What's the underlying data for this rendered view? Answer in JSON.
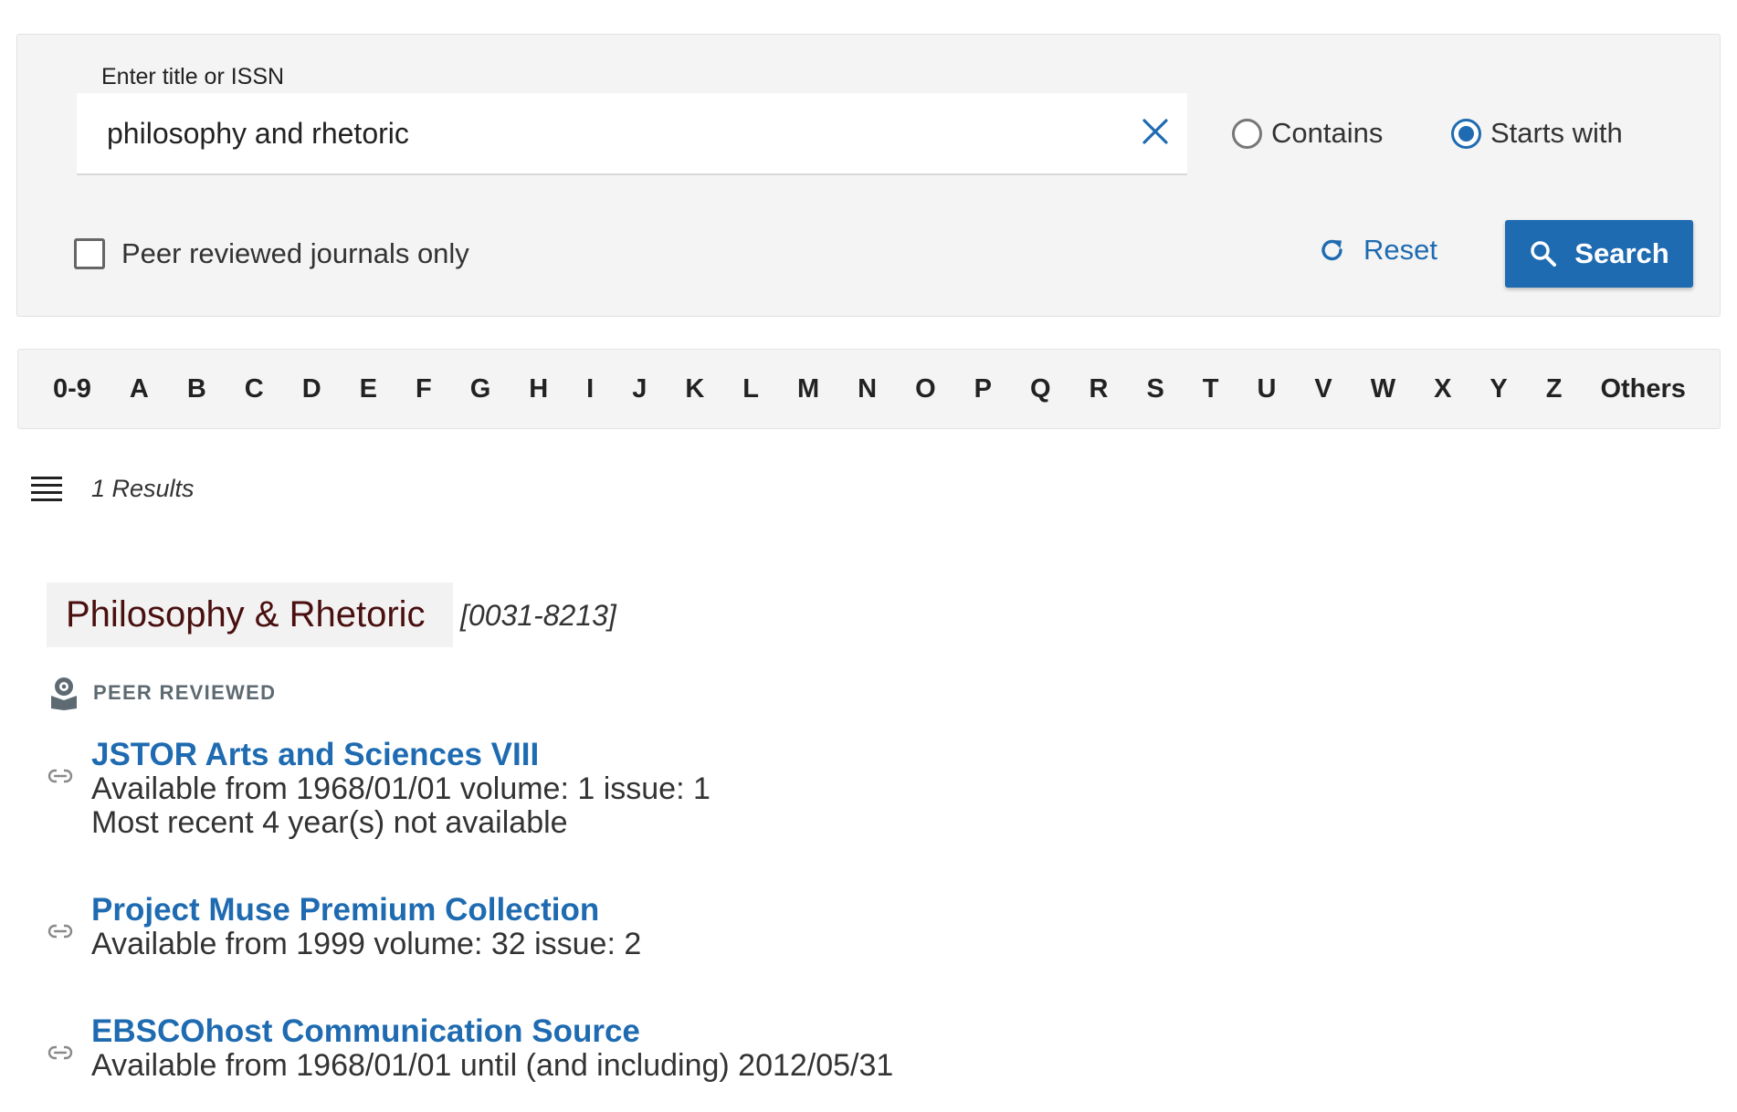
{
  "search": {
    "label": "Enter title or ISSN",
    "value": "philosophy and rhetoric",
    "options": [
      {
        "label": "Contains",
        "selected": false
      },
      {
        "label": "Starts with",
        "selected": true
      }
    ],
    "peer_reviewed_only": {
      "label": "Peer reviewed journals only",
      "checked": false
    },
    "reset_label": "Reset",
    "search_label": "Search"
  },
  "alphabet": [
    "0-9",
    "A",
    "B",
    "C",
    "D",
    "E",
    "F",
    "G",
    "H",
    "I",
    "J",
    "K",
    "L",
    "M",
    "N",
    "O",
    "P",
    "Q",
    "R",
    "S",
    "T",
    "U",
    "V",
    "W",
    "X",
    "Y",
    "Z",
    "Others"
  ],
  "results": {
    "count_text": "1 Results",
    "items": [
      {
        "title": "Philosophy & Rhetoric",
        "issn": "[0031-8213]",
        "peer_reviewed_label": "PEER REVIEWED",
        "providers": [
          {
            "name": "JSTOR Arts and Sciences VIII",
            "lines": [
              "Available from 1968/01/01 volume: 1 issue: 1",
              "Most recent 4 year(s) not available"
            ]
          },
          {
            "name": "Project Muse Premium Collection",
            "lines": [
              "Available from 1999 volume: 32 issue: 2"
            ]
          },
          {
            "name": "EBSCOhost Communication Source",
            "lines": [
              "Available from 1968/01/01 until (and including) 2012/05/31"
            ]
          }
        ]
      }
    ]
  },
  "colors": {
    "accent": "#1f6bb1",
    "title": "#4a0f0f",
    "panel": "#f4f4f4"
  },
  "icons": [
    "close-icon",
    "refresh-icon",
    "search-icon",
    "list-icon",
    "peer-reviewed-icon",
    "link-icon"
  ]
}
